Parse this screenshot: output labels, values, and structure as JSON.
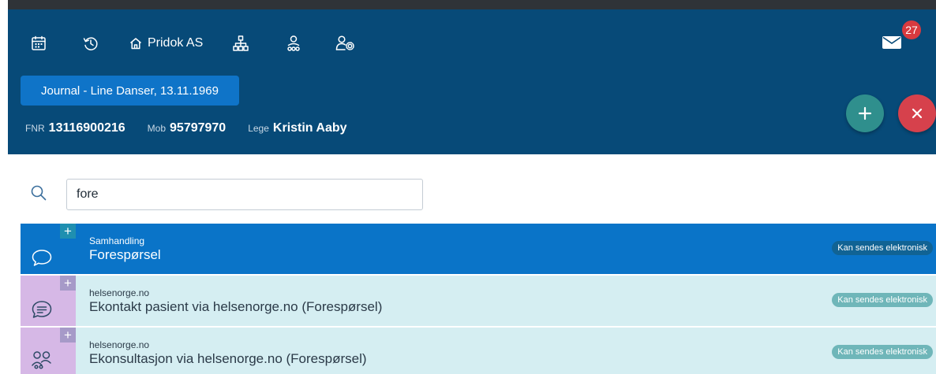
{
  "header": {
    "org_name": "Pridok AS",
    "mail_count": "27",
    "journal_button": "Journal - Line Danser, 13.11.1969",
    "patient": {
      "fnr_label": "FNR",
      "fnr_value": "13116900216",
      "mob_label": "Mob",
      "mob_value": "95797970",
      "lege_label": "Lege",
      "lege_value": "Kristin Aaby"
    },
    "nav_icons": [
      "calendar-icon",
      "history-icon",
      "home-icon",
      "org-chart-icon",
      "patient-group-icon",
      "user-settings-icon",
      "mail-icon"
    ],
    "fab_add": "+",
    "fab_close": "×"
  },
  "search": {
    "value": "fore",
    "placeholder": ""
  },
  "results": [
    {
      "category": "Samhandling",
      "title": "Forespørsel",
      "tag": "Kan sendes elektronisk",
      "plus": "+",
      "icon": "speech-bubble-icon",
      "selected": true
    },
    {
      "category": "helsenorge.no",
      "title": "Ekontakt pasient via helsenorge.no (Forespørsel)",
      "tag": "Kan sendes elektronisk",
      "plus": "+",
      "icon": "message-lines-icon",
      "selected": false
    },
    {
      "category": "helsenorge.no",
      "title": "Ekonsultasjon via helsenorge.no (Forespørsel)",
      "tag": "Kan sendes elektronisk",
      "plus": "+",
      "icon": "video-consultation-icon",
      "selected": false
    }
  ],
  "colors": {
    "header_bg": "#074a78",
    "journal_btn": "#0f74c8",
    "selected_row": "#0a74c8",
    "row_bg": "#d5eef2",
    "tile_bg": "#d6b8e6",
    "fab_add": "#2f8f8d",
    "fab_close": "#d6414c",
    "badge": "#d83a3f"
  }
}
